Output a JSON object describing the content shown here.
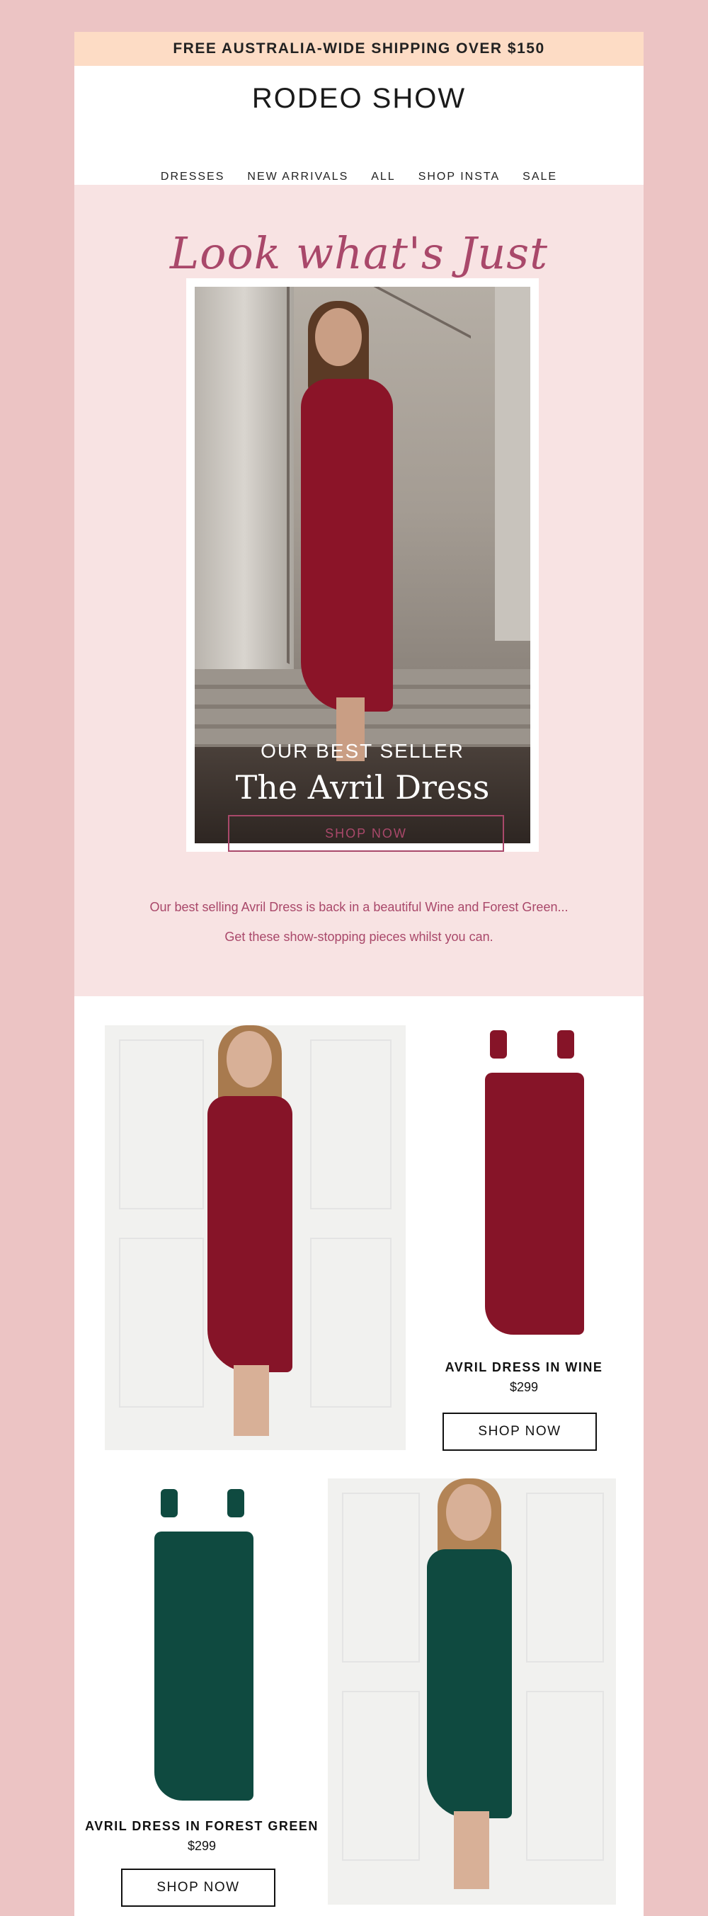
{
  "header": {
    "shipping_banner": "FREE AUSTRALIA-WIDE SHIPPING OVER $150",
    "logo": "RODEO SHOW",
    "nav": [
      "DRESSES",
      "NEW ARRIVALS",
      "ALL",
      "SHOP INSTA",
      "SALE"
    ]
  },
  "hero": {
    "headline": "Look what's Just arrived...",
    "overlay_subtitle": "OUR BEST SELLER",
    "overlay_title": "The Avril Dress",
    "body_line1": "Our best selling Avril Dress is back in a beautiful Wine and Forest Green...",
    "body_line2": "Get these show-stopping pieces whilst you can.",
    "cta": "SHOP NOW"
  },
  "products": [
    {
      "name": "AVRIL DRESS IN WINE",
      "price": "$299",
      "cta": "SHOP NOW",
      "color": "#861428"
    },
    {
      "name": "AVRIL DRESS IN FOREST GREEN",
      "price": "$299",
      "cta": "SHOP NOW",
      "color": "#0f4a40"
    }
  ],
  "colors": {
    "page_bg": "#ecc4c4",
    "banner_bg": "#fddcc5",
    "hero_bg": "#f8e3e3",
    "accent": "#a9486a"
  }
}
